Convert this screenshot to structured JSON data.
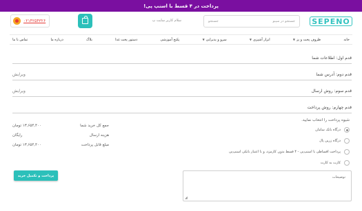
{
  "promo": {
    "text": "پرداخت در ۴ قسط با اسنپ پی!"
  },
  "header": {
    "logo": "SEPENO",
    "search_placeholder": "جستجو در سپنو",
    "search_button": "جستجو",
    "greeting": "سلام کاربر سایت پ",
    "phone": "۰۲۱۴۲۵۴۳۲۶"
  },
  "nav": {
    "items": [
      {
        "label": "خانه",
        "has_caret": false
      },
      {
        "label": "ظروف پخت و پز",
        "has_caret": true
      },
      {
        "label": "ابزار آشپزی",
        "has_caret": true
      },
      {
        "label": "سرو و پذیرایی",
        "has_caret": true
      },
      {
        "label": "پکیج آموزشی",
        "has_caret": false
      },
      {
        "label": "دستور پخت غذا",
        "has_caret": false
      },
      {
        "label": "بلاگ",
        "has_caret": false
      },
      {
        "label": "درباره ما",
        "has_caret": false
      },
      {
        "label": "تماس با ما",
        "has_caret": false
      }
    ]
  },
  "steps": [
    {
      "label": "قدم اول: اطلاعات شما",
      "edit": ""
    },
    {
      "label": "قدم دوم: آدرس شما",
      "edit": "ویرایش"
    },
    {
      "label": "قدم سوم: روش ارسال",
      "edit": "ویرایش"
    },
    {
      "label": "قدم چهارم: روش پرداخت",
      "edit": ""
    }
  ],
  "payment": {
    "title": "شیوه پرداخت را انتخاب نمایید.",
    "options": [
      {
        "label": "درگاه بانک سامان",
        "selected": true
      },
      {
        "label": "درگاه زرین پال",
        "selected": false
      },
      {
        "label": "پرداخت اقساطی با اسنپ‌پی - ۴ قسط بدون کارمزد، و با اعتبار بانکی اسنپ‌پی",
        "selected": false
      },
      {
        "label": "کارت به کارت",
        "selected": false
      }
    ]
  },
  "summary": {
    "rows": [
      {
        "label": "جمع کل خرید شما",
        "value": "۱۳,۶۵۴,۴۰۰ تومان"
      },
      {
        "label": "هزینه ارسال",
        "value": "رایگان"
      },
      {
        "label": "مبلغ قابل پرداخت",
        "value": "۱۳,۶۵۴,۴۰۰ تومان"
      }
    ]
  },
  "submit_label": "پرداخت و تکمیل خرید",
  "notes_label": "توضیحات",
  "colors": {
    "promo_bg": "#7a0fa0",
    "accent": "#2cc0ba",
    "phone_text": "#e53935"
  },
  "icons": [
    "cart-icon",
    "phone-icon",
    "chevron-down-icon",
    "resize-handle-icon"
  ]
}
